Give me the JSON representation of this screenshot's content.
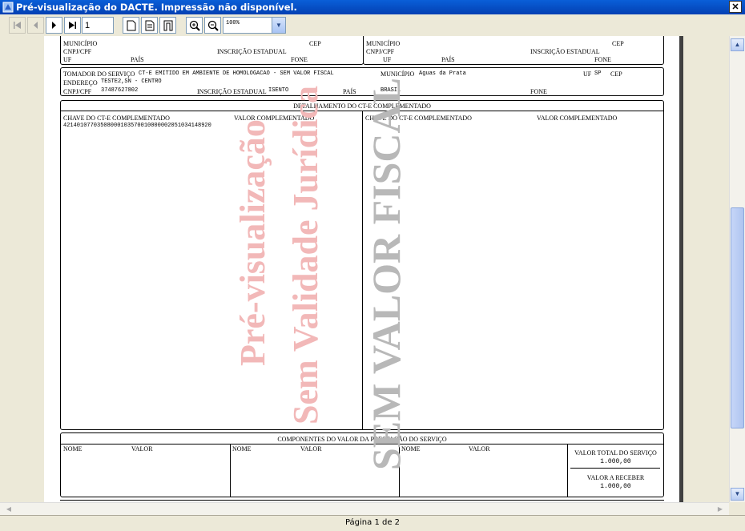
{
  "window": {
    "title": "Pré-visualização do DACTE. Impressão não disponível.",
    "close_glyph": "✕"
  },
  "toolbar": {
    "first_icon": "first-page-icon",
    "prev_icon": "previous-page-icon",
    "next_icon": "next-page-icon",
    "last_icon": "last-page-icon",
    "page_value": "1",
    "zoom_value": "100%"
  },
  "document": {
    "remetente_dest": {
      "left": {
        "municipio": "MUNICÍPIO",
        "cep": "CEP",
        "cnpj": "CNPJ/CPF",
        "ie": "INSCRIÇÃO ESTADUAL",
        "uf": "UF",
        "pais": "PAÍS",
        "fone": "FONE"
      },
      "right": {
        "municipio": "MUNICÍPIO",
        "cep": "CEP",
        "cnpj": "CNPJ/CPF",
        "ie": "INSCRIÇÃO ESTADUAL",
        "uf": "UF",
        "pais": "PAÍS",
        "fone": "FONE"
      }
    },
    "tomador": {
      "label": "TOMADOR DO SERVIÇO",
      "nome": "CT-E EMITIDO EM AMBIENTE DE HOMOLOGACAO - SEM VALOR FISCAL",
      "municipio_label": "MUNICÍPIO",
      "municipio": "Aguas da Prata",
      "uf_label": "UF",
      "uf": "SP",
      "cep_label": "CEP",
      "endereco_label": "ENDEREÇO",
      "endereco": "TESTE2,SN - CENTRO",
      "cnpj_label": "CNPJ/CPF",
      "cnpj": "37487627802",
      "ie_label": "INSCRIÇÃO ESTADUAL",
      "ie": "ISENTO",
      "pais_label": "PAÍS",
      "pais": "BRASIL",
      "fone_label": "FONE"
    },
    "detalhamento": {
      "title": "DETALHAMENTO DO CT-E COMPLEMENTADO",
      "left_chave_label": "CHAVE DO CT-E COMPLEMENTADO",
      "left_valor_label": "VALOR COMPLEMENTADO",
      "left_chave": "42140107703508000103570010000002051034148920",
      "right_chave_label": "CHAVE DO CT-E COMPLEMENTADO",
      "right_valor_label": "VALOR COMPLEMENTADO"
    },
    "componentes": {
      "title": "COMPONENTES DO VALOR DA PRESTAÇÃO DO SERVIÇO",
      "nome_label": "NOME",
      "valor_label": "VALOR",
      "total_label": "VALOR TOTAL DO SERVIÇO",
      "total_value": "1.000,00",
      "receber_label": "VALOR A RECEBER",
      "receber_value": "1.000,00"
    },
    "watermarks": {
      "line1": "Pré-visualização",
      "line2": "Sem Validade Jurídica",
      "line3": "SEM VALOR FISCAL"
    },
    "colors": {
      "watermark_red": "#f2b8b8",
      "watermark_gray": "#b8b8b8"
    }
  },
  "status": {
    "page_info": "Página 1 de 2"
  }
}
